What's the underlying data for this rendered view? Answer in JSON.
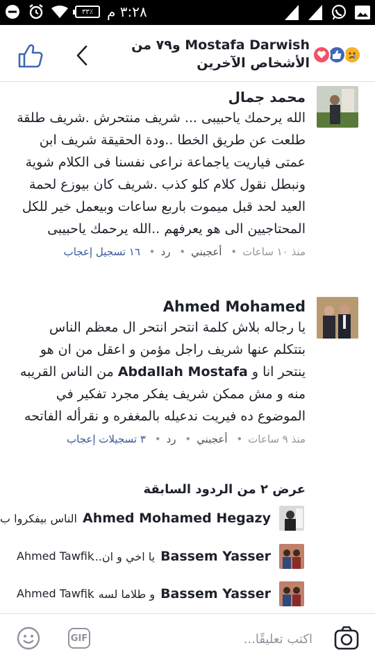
{
  "status_bar": {
    "time": "٣:٢٨ م",
    "battery": "٪٣٣"
  },
  "header": {
    "reactors_line1": "Mostafa Darwish و٧٩ من",
    "reactors_line2": "الأشخاص الآخرين",
    "colors": {
      "like_blue": "#4267b2",
      "love_red": "#f25268",
      "sad_yellow": "#f7b125"
    }
  },
  "comments": [
    {
      "author": "محمد جمال",
      "text": "الله يرحمك ياحبيبى ... شريف منتحرش .شريف طلقة طلعت عن طريق الخطا ..ودة الحقيقة شريف ابن عمتى فياريت ياجماعة نراعى نفسنا فى الكلام شوية ونبطل نقول كلام كلو كذب .شريف كان بيوزع لحمة العيد لحد قبل ميموت باربع ساعات وبيعمل خير للكل المحتاجيين الى هو يعرفهم ..الله يرحمك ياحبيبى",
      "time": "منذ ١٠ ساعات",
      "like": "أعجبني",
      "reply": "رد",
      "likes": "١٦ تسجيل إعجاب"
    },
    {
      "author": "Ahmed Mohamed",
      "text_before": "يا رجاله بلاش كلمة انتحر انتحر ال معظم الناس بتتكلم عنها شريف راجل مؤمن و اعقل من ان هو ينتحر انا و",
      "mention": "Abdallah Mostafa",
      "text_after": "من الناس القريبه منه و مش ممكن شريف يفكر مجرد تفكير في الموضوع ده فيريت ندعيله بالمغفره و نقرأله الفاتحه",
      "time": "منذ ٩ ساعات",
      "like": "أعجبني",
      "reply": "رد",
      "likes": "٣ تسجيلات إعجاب"
    }
  ],
  "previous_replies_label": "عرض ٢ من الردود السابقة",
  "replies": [
    {
      "name": "Ahmed Mohamed Hegazy",
      "snippet": "الناس بيفكروا ب..."
    },
    {
      "name": "Bassem Yasser",
      "snippet": "يا اخي و ان...",
      "tag": "Ahmed Tawfik"
    },
    {
      "name": "Bassem Yasser",
      "snippet": "و طلاما لسه ...",
      "tag": "Ahmed Tawfik"
    }
  ],
  "composer": {
    "placeholder": "اكتب تعليقًا...",
    "gif_label": "GIF"
  }
}
